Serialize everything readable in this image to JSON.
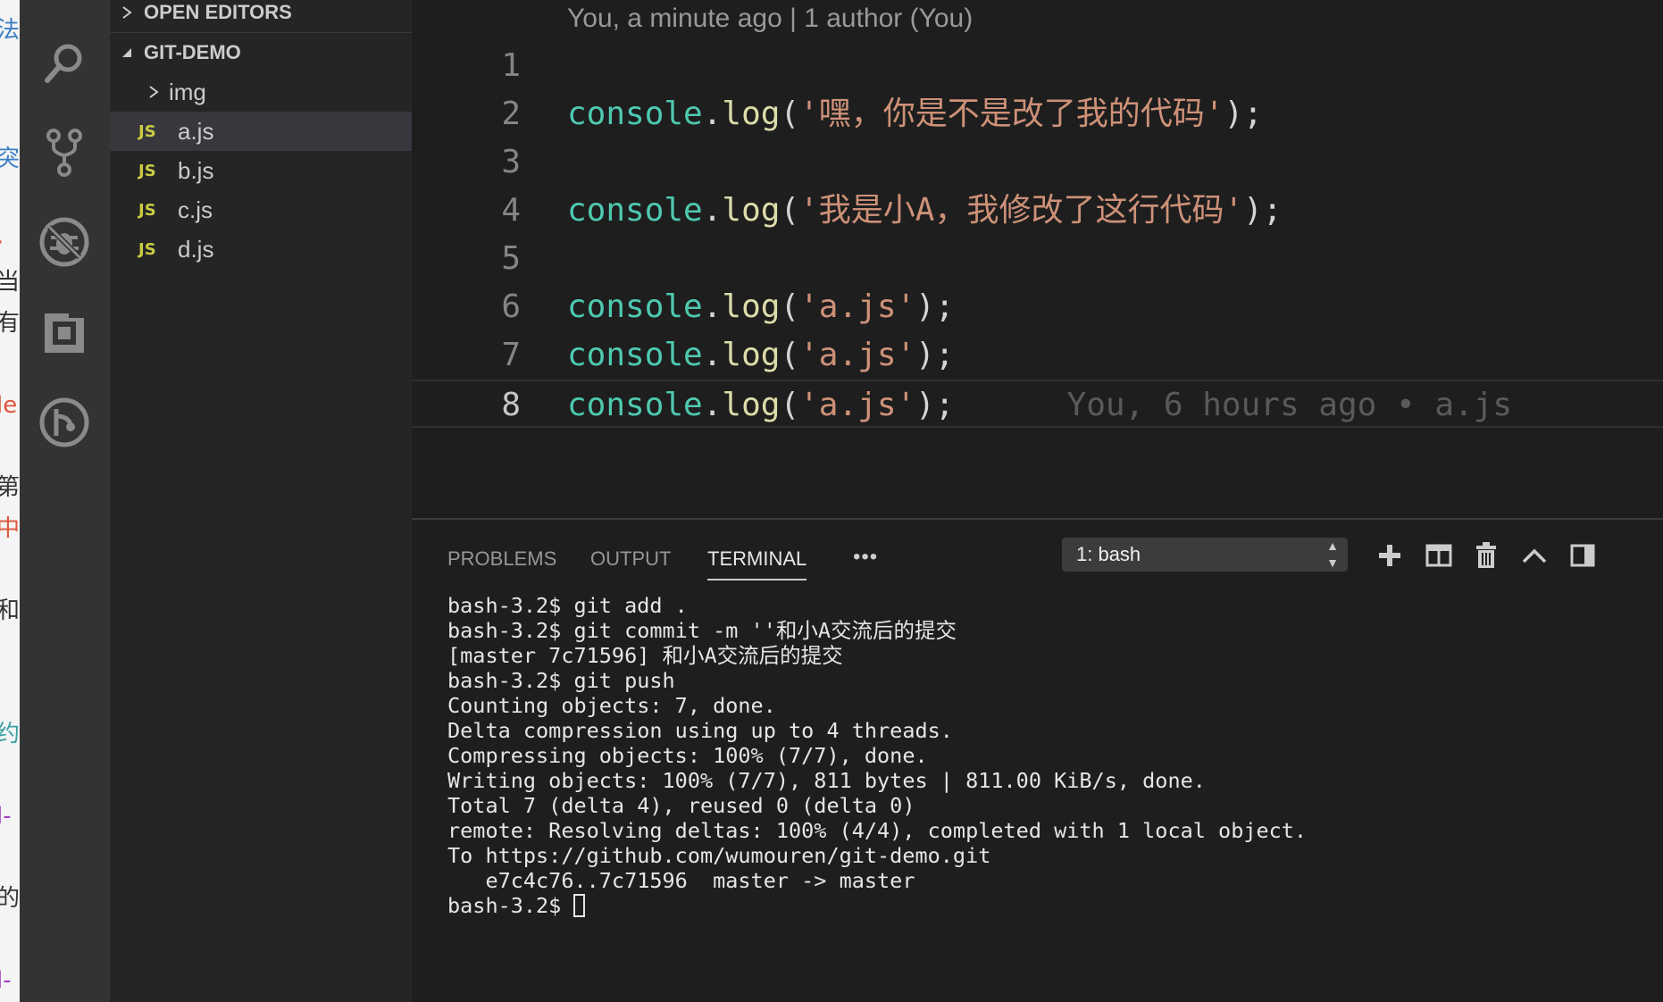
{
  "background_page": {
    "chars": [
      "法",
      "突",
      "·",
      "当",
      "有",
      "le",
      "第",
      "中",
      "和",
      "约",
      "l-",
      "的",
      "l-"
    ]
  },
  "activity_bar": {
    "items": [
      {
        "icon": "search-icon"
      },
      {
        "icon": "source-control-icon"
      },
      {
        "icon": "debug-icon"
      },
      {
        "icon": "extensions-icon"
      },
      {
        "icon": "gitlens-icon"
      }
    ]
  },
  "explorer": {
    "open_editors_label": "OPEN EDITORS",
    "folder_label": "GIT-DEMO",
    "file_type_badge": "JS",
    "items": [
      {
        "label": "img",
        "type": "folder"
      },
      {
        "label": "a.js",
        "type": "js",
        "selected": true
      },
      {
        "label": "b.js",
        "type": "js"
      },
      {
        "label": "c.js",
        "type": "js"
      },
      {
        "label": "d.js",
        "type": "js"
      }
    ]
  },
  "editor": {
    "codelens": "You, a minute ago | 1 author (You)",
    "lines": [
      {
        "num": "1",
        "object": "",
        "dot": "",
        "method": "",
        "open": "",
        "string": "",
        "close": ""
      },
      {
        "num": "2",
        "object": "console",
        "dot": ".",
        "method": "log",
        "open": "(",
        "string": "'嘿，你是不是改了我的代码'",
        "close": ");"
      },
      {
        "num": "3",
        "object": "",
        "dot": "",
        "method": "",
        "open": "",
        "string": "",
        "close": ""
      },
      {
        "num": "4",
        "object": "console",
        "dot": ".",
        "method": "log",
        "open": "(",
        "string": "'我是小A，我修改了这行代码'",
        "close": ");"
      },
      {
        "num": "5",
        "object": "",
        "dot": "",
        "method": "",
        "open": "",
        "string": "",
        "close": ""
      },
      {
        "num": "6",
        "object": "console",
        "dot": ".",
        "method": "log",
        "open": "(",
        "string": "'a.js'",
        "close": ");"
      },
      {
        "num": "7",
        "object": "console",
        "dot": ".",
        "method": "log",
        "open": "(",
        "string": "'a.js'",
        "close": ");"
      },
      {
        "num": "8",
        "object": "console",
        "dot": ".",
        "method": "log",
        "open": "(",
        "string": "'a.js'",
        "close": ");",
        "blame": "You, 6 hours ago • a.js",
        "current": true
      }
    ]
  },
  "panel": {
    "tabs": [
      {
        "label": "PROBLEMS"
      },
      {
        "label": "OUTPUT"
      },
      {
        "label": "TERMINAL",
        "active": true
      }
    ],
    "more_label": "•••",
    "terminal_select": "1: bash",
    "actions": [
      "plus-icon",
      "split-icon",
      "trash-icon",
      "chevron-up-icon",
      "panel-layout-icon"
    ],
    "terminal_lines": [
      "bash-3.2$ git add .",
      "bash-3.2$ git commit -m ''和小A交流后的提交",
      "[master 7c71596] 和小A交流后的提交",
      "bash-3.2$ git push",
      "Counting objects: 7, done.",
      "Delta compression using up to 4 threads.",
      "Compressing objects: 100% (7/7), done.",
      "Writing objects: 100% (7/7), 811 bytes | 811.00 KiB/s, done.",
      "Total 7 (delta 4), reused 0 (delta 0)",
      "remote: Resolving deltas: 100% (4/4), completed with 1 local object.",
      "To https://github.com/wumouren/git-demo.git",
      "   e7c4c76..7c71596  master -> master"
    ],
    "prompt": "bash-3.2$ "
  },
  "colors": {
    "editor_bg": "#1e1e1e",
    "sidebar_bg": "#252526",
    "activity_bg": "#333333",
    "token_object": "#4ec9b0",
    "token_method": "#dcdcaa",
    "token_string": "#ce9178",
    "js_badge": "#cbcb41"
  }
}
